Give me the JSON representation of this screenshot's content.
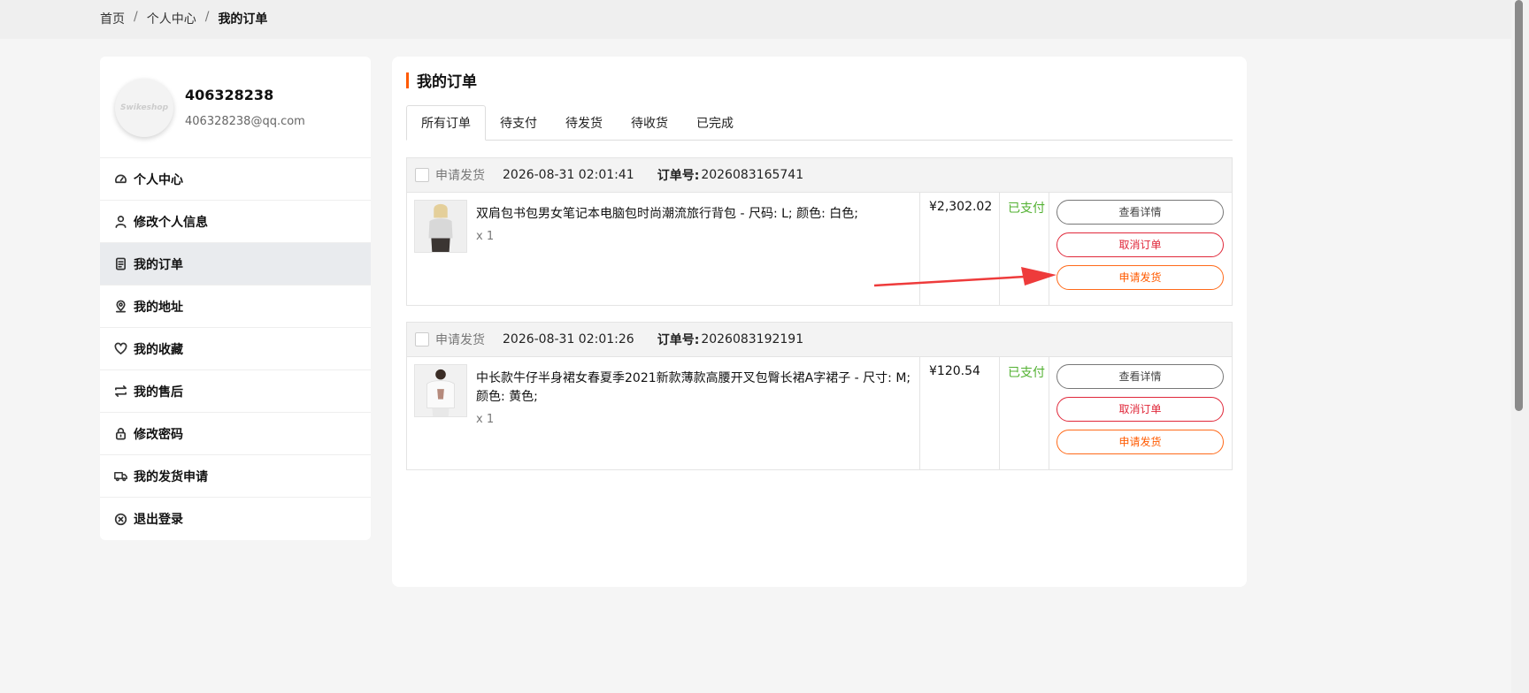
{
  "breadcrumb": {
    "home": "首页",
    "personal_center": "个人中心",
    "current": "我的订单",
    "separator": "/"
  },
  "profile": {
    "avatar_text": "Swikeshop",
    "username": "406328238",
    "email": "406328238@qq.com"
  },
  "sidebar": {
    "items": [
      {
        "label": "个人中心",
        "icon": "dashboard-icon"
      },
      {
        "label": "修改个人信息",
        "icon": "user-icon"
      },
      {
        "label": "我的订单",
        "icon": "document-icon",
        "active": true
      },
      {
        "label": "我的地址",
        "icon": "location-pin-icon"
      },
      {
        "label": "我的收藏",
        "icon": "heart-icon"
      },
      {
        "label": "我的售后",
        "icon": "exchange-icon"
      },
      {
        "label": "修改密码",
        "icon": "lock-icon"
      },
      {
        "label": "我的发货申请",
        "icon": "truck-icon"
      },
      {
        "label": "退出登录",
        "icon": "close-circle-icon"
      }
    ]
  },
  "main": {
    "title": "我的订单",
    "tabs": [
      {
        "label": "所有订单",
        "active": true
      },
      {
        "label": "待支付"
      },
      {
        "label": "待发货"
      },
      {
        "label": "待收货"
      },
      {
        "label": "已完成"
      }
    ]
  },
  "orders": [
    {
      "apply_label": "申请发货",
      "date": "2026-08-31 02:01:41",
      "order_no_label": "订单号:",
      "order_no": "2026083165741",
      "product_name": "双肩包书包男女笔记本电脑包时尚潮流旅行背包 - 尺码: L; 颜色: 白色;",
      "qty": "x 1",
      "price": "¥2,302.02",
      "status": "已支付",
      "actions": {
        "detail": "查看详情",
        "cancel": "取消订单",
        "ship": "申请发货"
      }
    },
    {
      "apply_label": "申请发货",
      "date": "2026-08-31 02:01:26",
      "order_no_label": "订单号:",
      "order_no": "2026083192191",
      "product_name": "中长款牛仔半身裙女春夏季2021新款薄款高腰开叉包臀长裙A字裙子 - 尺寸: M; 颜色: 黄色;",
      "qty": "x 1",
      "price": "¥120.54",
      "status": "已支付",
      "actions": {
        "detail": "查看详情",
        "cancel": "取消订单",
        "ship": "申请发货"
      }
    }
  ],
  "colors": {
    "accent": "#ff5a00",
    "paid": "#52b131",
    "cancel": "#e0283a",
    "arrow": "#ee3b3b"
  }
}
